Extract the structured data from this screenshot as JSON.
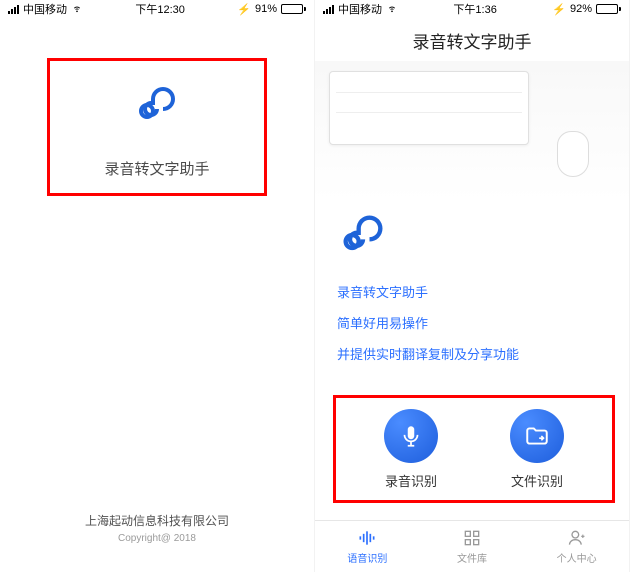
{
  "colors": {
    "brand": "#2b6fff",
    "highlight_box": "#ff0000",
    "battery_green": "#4cd964"
  },
  "phone1": {
    "status": {
      "carrier": "中国移动",
      "time": "下午12:30",
      "battery_icon": "⚡",
      "battery_pct": "91%"
    },
    "app_name": "录音转文字助手",
    "company": "上海起动信息科技有限公司",
    "copyright": "Copyright@ 2018"
  },
  "phone2": {
    "status": {
      "carrier": "中国移动",
      "time": "下午1:36",
      "battery_icon": "⚡",
      "battery_pct": "92%"
    },
    "title": "录音转文字助手",
    "intro": {
      "line1": "录音转文字助手",
      "line2": "简单好用易操作",
      "line3": "并提供实时翻译复制及分享功能"
    },
    "actions": {
      "record_label": "录音识别",
      "file_label": "文件识别"
    },
    "tabs": {
      "voice": "语音识别",
      "files": "文件库",
      "me": "个人中心"
    }
  }
}
